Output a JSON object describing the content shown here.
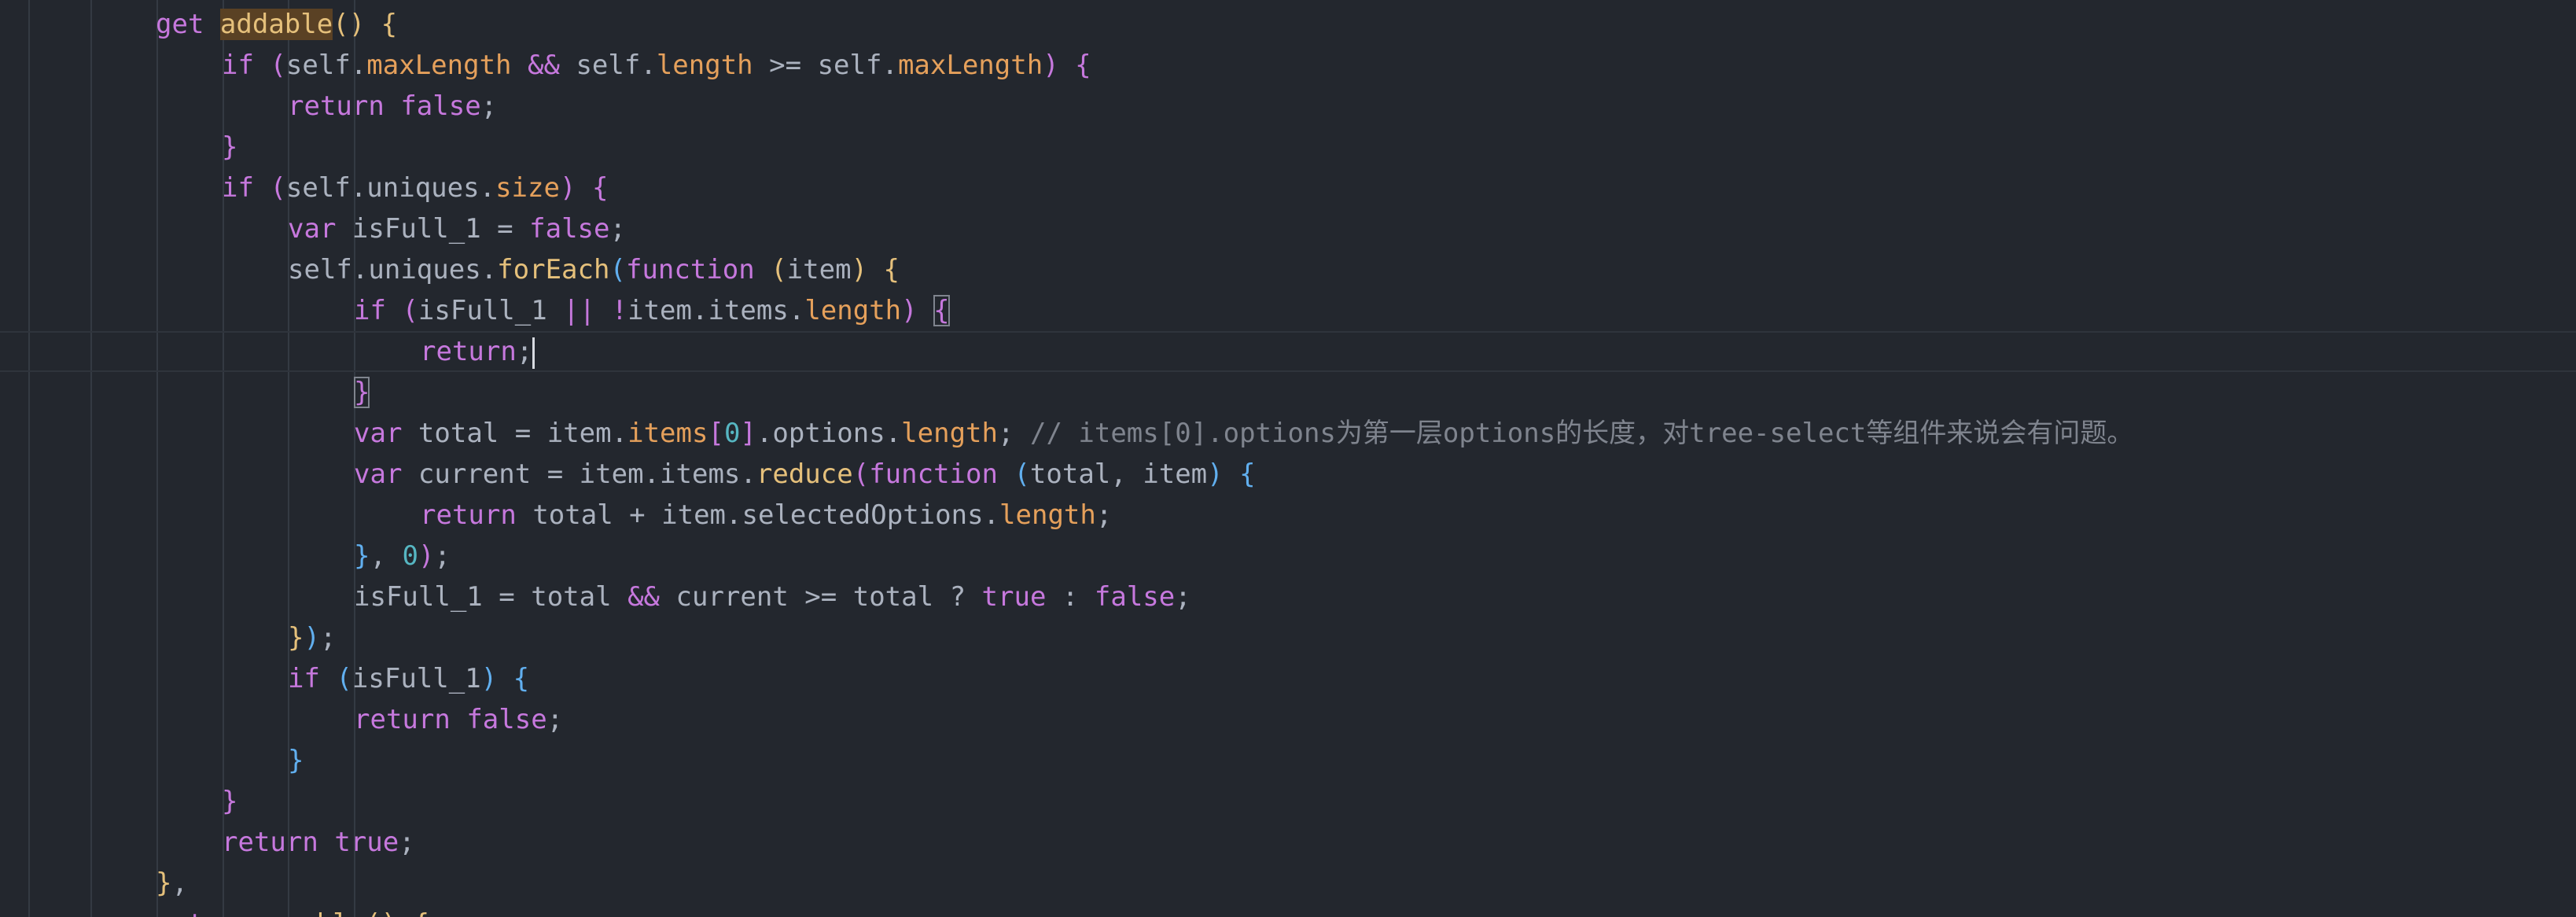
{
  "editor": {
    "language": "javascript",
    "theme_colors": {
      "background": "#23272e",
      "text": "#abb2bf",
      "keyword": "#c678dd",
      "function": "#e5c07b",
      "property": "#e5a05b",
      "number": "#56b6c2",
      "comment": "#7f848e",
      "bracket_level1": "#e5c07b",
      "bracket_level2": "#c678dd",
      "bracket_level3": "#61afef"
    },
    "lines": [
      {
        "text": "get addable() {"
      },
      {
        "text": "if (self.maxLength && self.length >= self.maxLength) {"
      },
      {
        "text": "return false;"
      },
      {
        "text": "}"
      },
      {
        "text": "if (self.uniques.size) {"
      },
      {
        "text": "var isFull_1 = false;"
      },
      {
        "text": "self.uniques.forEach(function (item) {"
      },
      {
        "text": "if (isFull_1 || !item.items.length) {"
      },
      {
        "text": "return;"
      },
      {
        "text": "}"
      },
      {
        "text": "var total = item.items[0].options.length; // items[0].options为第一层options的长度，对tree-select等组件来说会有问题。"
      },
      {
        "text": "var current = item.items.reduce(function (total, item) {"
      },
      {
        "text": "return total + item.selectedOptions.length;"
      },
      {
        "text": "}, 0);"
      },
      {
        "text": "isFull_1 = total && current >= total ? true : false;"
      },
      {
        "text": "});"
      },
      {
        "text": "if (isFull_1) {"
      },
      {
        "text": "return false;"
      },
      {
        "text": "}"
      },
      {
        "text": "}"
      },
      {
        "text": "return true;"
      },
      {
        "text": "},"
      },
      {
        "text": "get removable() {"
      }
    ],
    "t": {
      "get": "get",
      "addable": "addable",
      "removable": "removable",
      "if": "if",
      "return": "return",
      "var": "var",
      "function": "function",
      "false": "false",
      "true": "true",
      "self": "self",
      "item": "item",
      "items": "items",
      "uniques": "uniques",
      "maxLength": "maxLength",
      "length": "length",
      "size": "size",
      "forEach": "forEach",
      "reduce": "reduce",
      "options": "options",
      "selectedOptions": "selectedOptions",
      "isFull_1": "isFull_1",
      "total": "total",
      "current": "current",
      "zero": "0",
      "comment": "// items[0].options为第一层options的长度，对tree-select等组件来说会有问题。"
    },
    "p": {
      "paren_open": "(",
      "paren_close": ")",
      "brace_open": "{",
      "brace_close": "}",
      "bracket_open": "[",
      "bracket_close": "]",
      "dot": ".",
      "semi": ";",
      "comma": ",",
      "space": " ",
      "and": "&&",
      "or": "||",
      "not": "!",
      "gte": ">=",
      "eq": "=",
      "plus": "+",
      "q": "?",
      "colon": ":"
    }
  }
}
